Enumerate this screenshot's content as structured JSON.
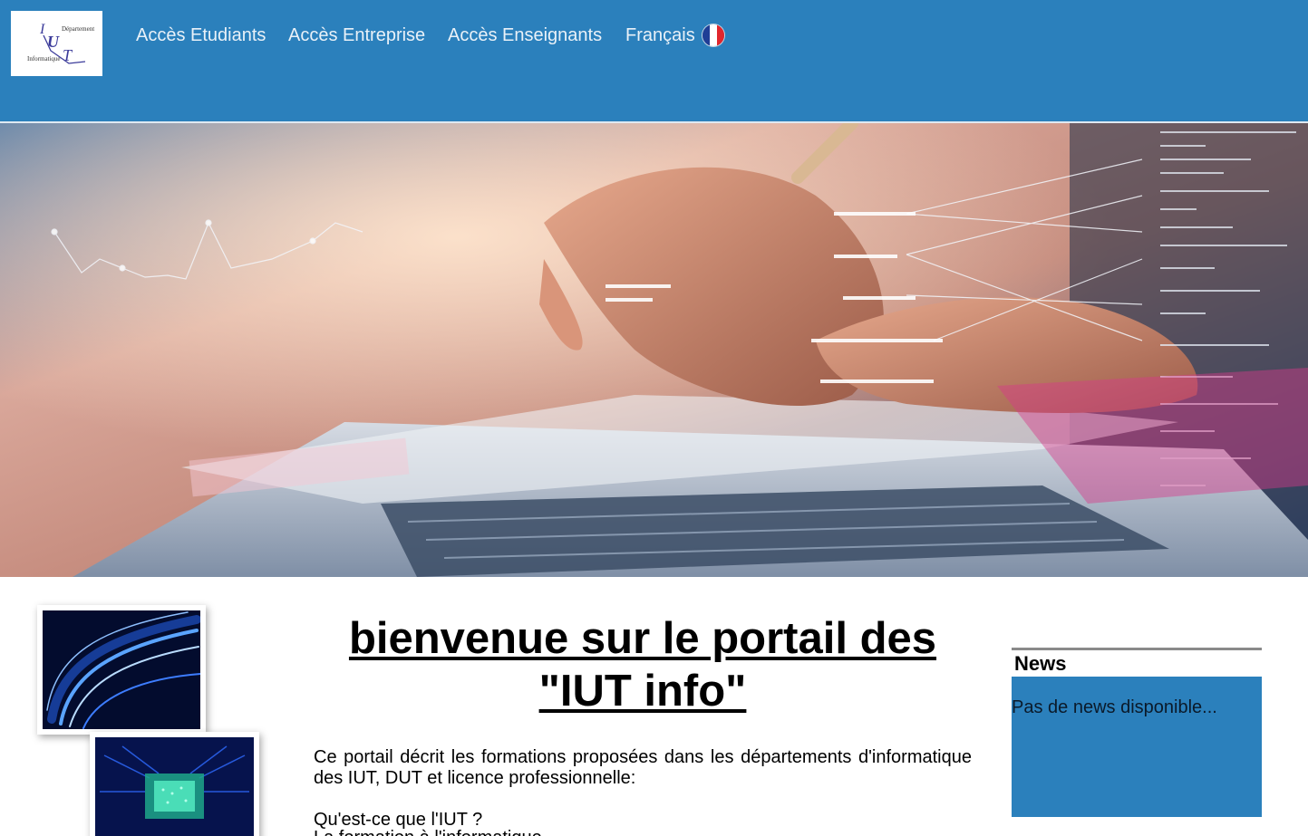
{
  "header": {
    "logo": {
      "text_top": "Département",
      "text_bottom": "Informatique",
      "letters": "IUT"
    },
    "nav": [
      {
        "label": "Accès Etudiants"
      },
      {
        "label": "Accès Entreprise"
      },
      {
        "label": "Accès Enseignants"
      },
      {
        "label": "Français",
        "icon": "france-flag-icon"
      }
    ],
    "colors": {
      "bar": "#2b80bc",
      "nav_text": "#e9f1f8",
      "flag_blue": "#1f3e96",
      "flag_white": "#ffffff",
      "flag_red": "#e1262d"
    }
  },
  "banner": {
    "icon": "hands-laptop-data-illustration"
  },
  "sidebar_images": [
    {
      "icon": "fiber-optic-light-icon"
    },
    {
      "icon": "circuit-board-chip-icon"
    }
  ],
  "main": {
    "title_line1": "bienvenue sur le portail des",
    "title_line2": "\"IUT info\"",
    "intro": "Ce portail décrit les formations proposées dans les départements d'informatique des IUT, DUT et licence professionnelle:",
    "links": [
      {
        "label": "Qu'est-ce que l'IUT ?"
      },
      {
        "label": "La formation à l'informatique"
      }
    ]
  },
  "news": {
    "title": "News",
    "empty": "Pas de news disponible...",
    "colors": {
      "box": "#2b80bc",
      "rule": "#8a8a8a"
    }
  }
}
